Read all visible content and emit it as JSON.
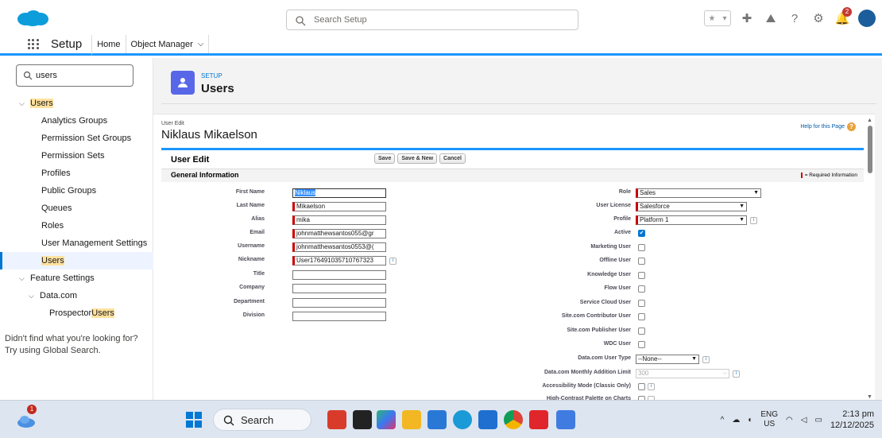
{
  "header": {
    "search_placeholder": "Search Setup",
    "notification_count": "2",
    "icons": [
      "star-icon",
      "dropdown-icon",
      "add-icon",
      "trailhead-icon",
      "help-icon",
      "gear-icon",
      "bell-icon",
      "avatar"
    ]
  },
  "nav": {
    "app_name": "Setup",
    "tabs": [
      {
        "label": "Home"
      },
      {
        "label": "Object Manager"
      }
    ]
  },
  "sidebar": {
    "search_value": "users",
    "items": [
      {
        "label": "Users"
      },
      {
        "label": "Analytics Groups"
      },
      {
        "label": "Permission Set Groups"
      },
      {
        "label": "Permission Sets"
      },
      {
        "label": "Profiles"
      },
      {
        "label": "Public Groups"
      },
      {
        "label": "Queues"
      },
      {
        "label": "Roles"
      },
      {
        "label": "User Management Settings"
      },
      {
        "label": "Users"
      },
      {
        "label": "Feature Settings"
      },
      {
        "label": "Data.com"
      },
      {
        "label": "Prospector ",
        "highlight": "Users"
      }
    ],
    "note": "Didn't find what you're looking for? Try using Global Search."
  },
  "page_header": {
    "setup_label": "SETUP",
    "title": "Users"
  },
  "record": {
    "crumb": "User Edit",
    "name": "Niklaus Mikaelson",
    "help_link": "Help for this Page"
  },
  "block": {
    "title": "User Edit",
    "buttons": {
      "save": "Save",
      "save_new": "Save & New",
      "cancel": "Cancel"
    },
    "section_title": "General Information",
    "required_info": "= Required Information"
  },
  "left_fields": [
    {
      "label": "First Name",
      "value": "Niklaus"
    },
    {
      "label": "Last Name",
      "value": "Mikaelson"
    },
    {
      "label": "Alias",
      "value": "mika"
    },
    {
      "label": "Email",
      "value": "johnmatthewsantos055@gr"
    },
    {
      "label": "Username",
      "value": "johnmatthewsantos0553@("
    },
    {
      "label": "Nickname",
      "value": "User176491035710767323"
    },
    {
      "label": "Title",
      "value": ""
    },
    {
      "label": "Company",
      "value": ""
    },
    {
      "label": "Department",
      "value": ""
    },
    {
      "label": "Division",
      "value": ""
    }
  ],
  "right_fields": {
    "role": {
      "label": "Role",
      "value": "Sales"
    },
    "user_license": {
      "label": "User License",
      "value": "Salesforce"
    },
    "profile": {
      "label": "Profile",
      "value": "Platform 1"
    },
    "checkboxes": [
      {
        "label": "Active",
        "checked": true
      },
      {
        "label": "Marketing User",
        "checked": false
      },
      {
        "label": "Offline User",
        "checked": false
      },
      {
        "label": "Knowledge User",
        "checked": false
      },
      {
        "label": "Flow User",
        "checked": false
      },
      {
        "label": "Service Cloud User",
        "checked": false
      },
      {
        "label": "Site.com Contributor User",
        "checked": false
      },
      {
        "label": "Site.com Publisher User",
        "checked": false
      },
      {
        "label": "WDC User",
        "checked": false
      }
    ],
    "datacom_user_type": {
      "label": "Data.com User Type",
      "value": "--None--"
    },
    "datacom_limit": {
      "label": "Data.com Monthly Addition Limit",
      "value": "300"
    },
    "accessibility": {
      "label": "Accessibility Mode (Classic Only)"
    },
    "contrast": {
      "label": "High-Contrast Palette on Charts"
    }
  },
  "taskbar": {
    "weather_badge": "1",
    "search_label": "Search",
    "lang_top": "ENG",
    "lang_bottom": "US",
    "time": "2:13 pm",
    "date": "12/12/2025"
  },
  "info_glyph": "i",
  "check_glyph": "✔"
}
